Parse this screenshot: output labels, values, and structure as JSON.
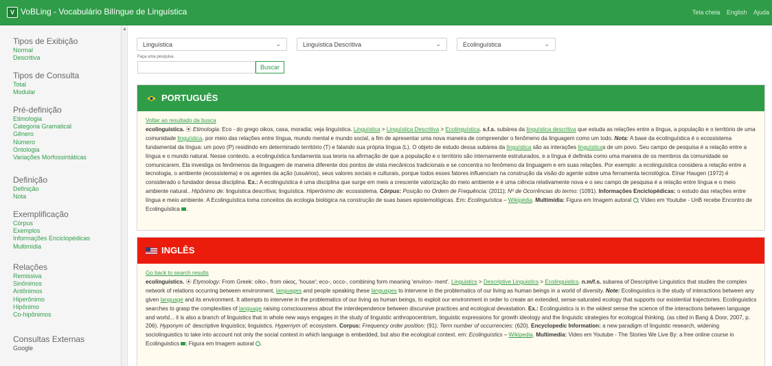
{
  "app": {
    "logo_text": "V",
    "title": "VoBLing - Vocabulário Bilíngue de Linguística",
    "top_links": [
      "Tela cheia",
      "English",
      "Ajuda"
    ]
  },
  "sidebar": {
    "sections": [
      {
        "title": "Tipos de Exibição",
        "items": [
          "Normal",
          "Descritiva"
        ]
      },
      {
        "title": "Tipos de Consulta",
        "items": [
          "Total",
          "Modular"
        ]
      },
      {
        "title": "Pré-definição",
        "items": [
          "Etimologia",
          "Categoria Gramatical",
          "Gênero",
          "Número",
          "Ontologia",
          "Variações Morfossintáticas"
        ]
      },
      {
        "title": "Definição",
        "items": [
          "Definição",
          "Nota"
        ]
      },
      {
        "title": "Exemplificação",
        "items": [
          "Córpus",
          "Exemplos",
          "Informações Enciclopédicas",
          "Multimídia"
        ]
      },
      {
        "title": "Relações",
        "items": [
          "Remissiva",
          "Sinônimos",
          "Antônimos",
          "Hiperônimo",
          "Hipônimo",
          "Co-hipônimos"
        ]
      },
      {
        "title": "Consultas Externas",
        "items": [
          "Google"
        ]
      }
    ]
  },
  "search": {
    "select1": "Linguística",
    "select2": "Linguística Descritiva",
    "select3": "Ecolinguística",
    "label": "Faça uma pesquisa.",
    "input_value": "",
    "button": "Buscar"
  },
  "colors": {
    "green": "#2f9c48",
    "red": "#ec1c0c",
    "link": "#2f9c48"
  },
  "pt": {
    "heading": "PORTUGUÊS",
    "back": "Voltar ao resultado da busca",
    "term": "ecolinguística.",
    "sym": "⦿",
    "etym_label": "Etimologia:",
    "etym_text": "Eco - do grego oikos, casa, moradia; veja linguística.",
    "bc1": "Linguística",
    "bc2": "Linguística Descritiva",
    "bc3": "Ecolinguística",
    "cat": "s.f.s.",
    "t1": "subárea da",
    "l1": "linguística descritiva",
    "t2": "que estuda as relações entre a língua, a população e o território de uma comunidade",
    "l2": "linguística",
    "t3": ", por meio das relações entre língua, mundo mental e mundo social, a fim de apresentar uma nova maneira de compreender o fenômeno da linguagem como um todo.",
    "nota_label": "Nota:",
    "t4": "A base da ecolinguística é o ecossistema fundamental da língua: um povo (P) residindo em determinado território (T) e falando sua própria língua (L). O objeto de estudo dessa subárea da",
    "l3": "linguística",
    "t5": "são as interações",
    "l4": "linguística",
    "t6": "s de um povo. Seu campo de pesquisa é a relação entre a língua e o mundo natural. Nesse contexto, a ecolinguística fundamenta sua teoria na afirmação de que a população e o território são internamente estruturados, e a língua é definida como uma maneira de os membros da comunidade se comunicarem. Ela investiga os fenômenos da linguagem de maneira diferente dos pontos de vista mecânicos tradicionais e se concentra no fenômeno da linguagem e em suas relações. Por exemplo: a ecolinguística considera a relação entre a tecnologia, o ambiente (ecossistema) e os agentes da ação (usuários), seus valores sociais e culturais, porque todos esses fatores influenciam na construção da visão do agente sobre uma ferramenta tecnológica. Einar Haugen (1972) é considerado o fundador dessa disciplina.",
    "ex_label": "Ex.:",
    "t7": "A ecolinguística é uma disciplina que surge em meio a crescente valorização do meio ambiente e é uma ciência relativamente nova e o seu campo de pesquisa é a relação entre língua e o meio ambiente natural..",
    "hyp_label": "Hipônimo de:",
    "hyp": "linguística descritiva; linguística.",
    "hyper_label": "Hiperônimo de:",
    "hyper": "ecossistema.",
    "corpus_label": "Córpus:",
    "pos_label": "Posição no Ordem de Frequência:",
    "pos": "(2011);",
    "occ_label": "Nº de Ocorrências do termo:",
    "occ": "(1091).",
    "enc_label": "Informações Enciclopédicas:",
    "t8": "o estudo das relações entre língua e meio ambiente. A Ecolinguística toma conceitos da ecologia biológica na construção de suas bases epistemológicas. Em:",
    "src": "Ecolinguística –",
    "wiki": "Wikipédia",
    "mm_label": "Multimídia:",
    "t9": "Figura em Imagem autoral",
    "t10": "; Vídeo em Youtube - UnB recebe Encontro de Ecolinguística"
  },
  "en": {
    "heading": "INGLÊS",
    "back": "Go back to search results",
    "term": "ecolinguistics.",
    "sym": "⦿",
    "etym_label": "Etymology:",
    "etym_text": "From Greek: oíko-, from οίκος, 'house'; eco-, occo-, combining form meaning 'environ- ment'.",
    "bc1": "Linguistics",
    "bc2": "Descriptive Linguistics",
    "bc3": "Ecolinguistics",
    "cat": "n.m/f.s.",
    "t1": "subarea of Descriptive Linguistics that studies the complex network of relations occurring between environment,",
    "l1": "languages",
    "t2": "and people speaking these",
    "l2": "languages",
    "t3": "to intervene in the problematics of our living as human beings in a world of diversity.",
    "note_label": "Note:",
    "t4": "Ecolinguistics is the study of interactions between any given",
    "l3": "language",
    "t5": "and its environment. It attempts to intervene in the problematics of our living as human beings, to exploit our environment in order to create an extended, sense-saturated ecology that supports our existential trajectories. Ecolinguistics searches to grasp the complexities of",
    "l4": "language",
    "t6": "raising consciousness about the interdependence between discursive practices and ecological devastation.",
    "ex_label": "Ex.:",
    "t7": "Ecolinguistics is in the widest sense the science of the interactions between language and world... it is also a branch of linguistics that in whole new ways engages in the study of linguistic anthropocentrism, linguistic expressions for growth ideology and the linguistic strategies for ecological thinking. (as cited in Bang & Door, 2007, p. 206).",
    "hypo_label": "Hyponym of:",
    "hypo": "descriptive linguistics; linguistics.",
    "hyper_label": "Hypernym of:",
    "hyper": "ecosystem.",
    "corpus_label": "Corpus:",
    "freq_label": "Frequency order position:",
    "freq": "(91);",
    "term_label": "Term number of occurrencies:",
    "term_n": "(620).",
    "enc_label": "Encyclopedic Information:",
    "t8": "a new paradigm of linguistic research, widening sociolinguistics to take into account not only the social context in which language is embedded, but also the ecological context. em:",
    "src": "Ecolinguistics –",
    "wiki": "Wikipedia",
    "mm_label": "Multimedia:",
    "t9": "Video em Youtube - The Stories We Live By: a free online course in Ecolinguistics",
    "t10": "; Figura em Imagem autoral"
  }
}
